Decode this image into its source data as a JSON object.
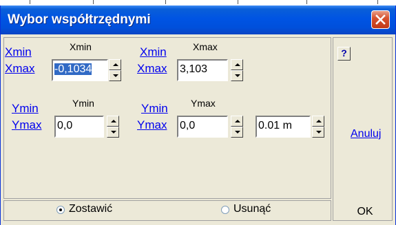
{
  "window": {
    "title": "Wybor współtrzędnymi",
    "close_glyph": "✕"
  },
  "x_section": {
    "left_group": {
      "link_min": "Xmin",
      "link_max": "Xmax",
      "column_label": "Xmin",
      "value": "-0,1034"
    },
    "right_group": {
      "link_min": "Xmin",
      "link_max": "Xmax",
      "column_label": "Xmax",
      "value": "3,103"
    }
  },
  "y_section": {
    "left_group": {
      "link_min": "Ymin",
      "link_max": "Ymax",
      "column_label": "Ymin",
      "value": "0,0"
    },
    "right_group": {
      "link_min": "Ymin",
      "link_max": "Ymax",
      "column_label": "Ymax",
      "value": "0,0"
    },
    "step_value": "0.01 m"
  },
  "options": {
    "keep_label": "Zostawić",
    "remove_label": "Usunąć",
    "selected": "keep"
  },
  "buttons": {
    "help": "?",
    "cancel": "Anuluj",
    "ok": "OK"
  }
}
